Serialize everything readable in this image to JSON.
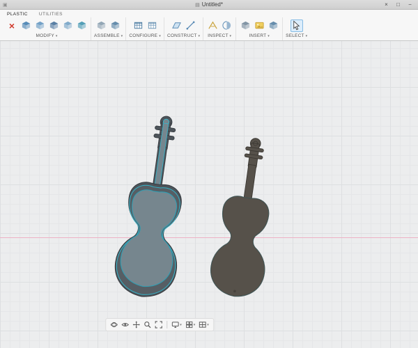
{
  "window": {
    "title": "Untitled*",
    "app_icon_glyph": "▣",
    "doc_icon_glyph": "▤",
    "close_glyph": "×",
    "maximize_glyph": "□",
    "minimize_glyph": "−"
  },
  "tabs": [
    {
      "label": "PLASTIC"
    },
    {
      "label": "UTILITIES"
    }
  ],
  "toolbar": {
    "caret": "▾",
    "groups": [
      {
        "label": "MODIFY",
        "icons": [
          "delete-icon",
          "press-pull-icon",
          "fillet-icon",
          "shell-icon",
          "combine-icon",
          "split-body-icon"
        ]
      },
      {
        "label": "ASSEMBLE",
        "icons": [
          "new-component-icon",
          "joint-icon"
        ]
      },
      {
        "label": "CONFIGURE",
        "icons": [
          "configure-icon",
          "configuration-table-icon"
        ]
      },
      {
        "label": "CONSTRUCT",
        "icons": [
          "offset-plane-icon",
          "construct-axis-icon"
        ]
      },
      {
        "label": "INSPECT",
        "icons": [
          "measure-icon",
          "section-analysis-icon"
        ]
      },
      {
        "label": "INSERT",
        "icons": [
          "insert-derive-icon",
          "decal-icon",
          "insert-mesh-icon"
        ]
      },
      {
        "label": "SELECT",
        "icons": [
          "select-cursor-icon"
        ],
        "selected": true
      }
    ]
  },
  "canvas": {
    "background": "#ecedee",
    "grid_minor_color": "#e5e6e8",
    "grid_major_color": "#dddfe1",
    "origin_line_color": "#eeb1c4",
    "objects": [
      {
        "name": "violin-case-shell",
        "body_color": "#4d545a",
        "rim_highlight_color": "#38b6cb",
        "floor_color": "#76868e"
      },
      {
        "name": "violin-top-plate",
        "body_color": "#56514a",
        "outline_color": "#3b3833"
      }
    ]
  },
  "navbar": {
    "caret": "▾",
    "icons": [
      "orbit-icon",
      "look-at-icon",
      "pan-icon",
      "zoom-icon",
      "fit-icon",
      "display-settings-icon",
      "grid-settings-icon",
      "viewports-icon"
    ]
  }
}
